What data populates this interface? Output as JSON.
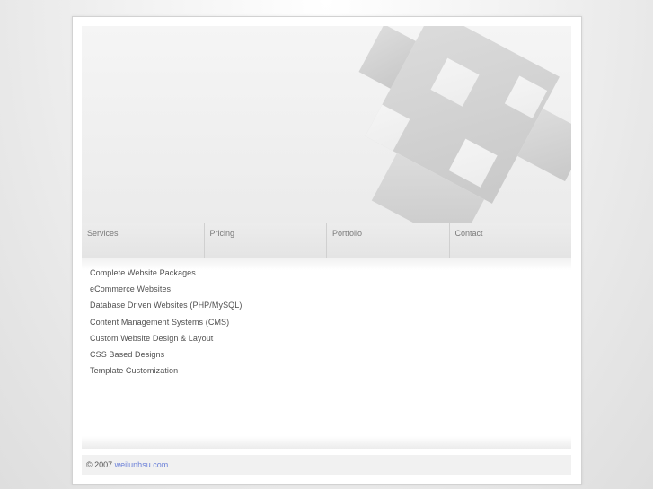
{
  "nav": {
    "items": [
      {
        "label": "Services"
      },
      {
        "label": "Pricing"
      },
      {
        "label": "Portfolio"
      },
      {
        "label": "Contact"
      }
    ]
  },
  "services": {
    "items": [
      {
        "label": "Complete Website Packages"
      },
      {
        "label": "eCommerce Websites"
      },
      {
        "label": "Database Driven Websites (PHP/MySQL)"
      },
      {
        "label": "Content Management Systems (CMS)"
      },
      {
        "label": "Custom Website Design & Layout"
      },
      {
        "label": "CSS Based Designs"
      },
      {
        "label": "Template Customization"
      }
    ]
  },
  "footer": {
    "copyright": "© 2007",
    "link_text": "weilunhsu.com",
    "suffix": "."
  },
  "colors": {
    "link": "#6b80d8",
    "nav_text": "#7a7a7a",
    "body_text": "#505050"
  }
}
